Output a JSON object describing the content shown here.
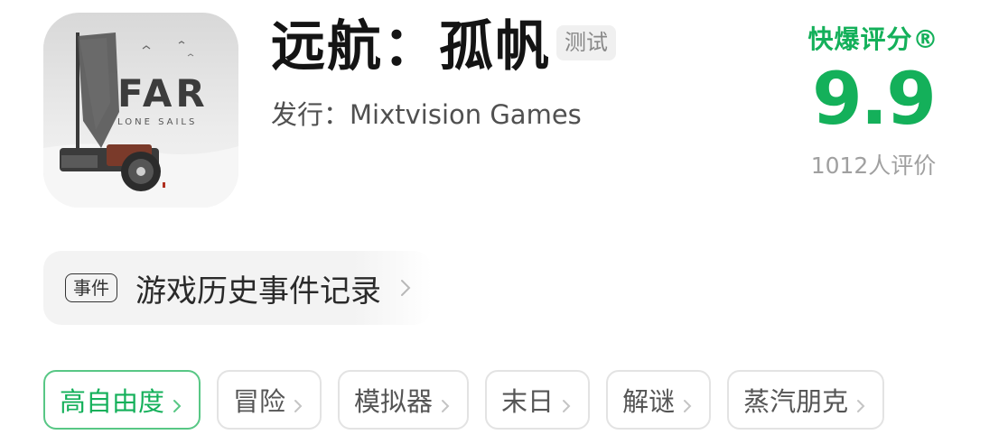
{
  "app": {
    "icon": "far-lone-sails-app-icon",
    "title": "远航：孤帆",
    "badge": "测试",
    "publisher": "发行：Mixtvision Games",
    "icon_text_main": "FAR",
    "icon_text_sub": "LONE SAILS"
  },
  "rating": {
    "label": "快爆评分®",
    "score": "9.9",
    "count": "1012人评价"
  },
  "events": {
    "badge": "事件",
    "label": "游戏历史事件记录"
  },
  "tags": [
    {
      "label": "高自由度",
      "active": true
    },
    {
      "label": "冒险",
      "active": false
    },
    {
      "label": "模拟器",
      "active": false
    },
    {
      "label": "末日",
      "active": false
    },
    {
      "label": "解谜",
      "active": false
    },
    {
      "label": "蒸汽朋克",
      "active": false
    }
  ],
  "colors": {
    "accent_green": "#14b05a",
    "active_tag_border": "#58c785",
    "tag_border": "#e3e3e3",
    "muted_text": "#a0a0a0"
  },
  "icons": {
    "chevron": "chevron-right-icon"
  }
}
